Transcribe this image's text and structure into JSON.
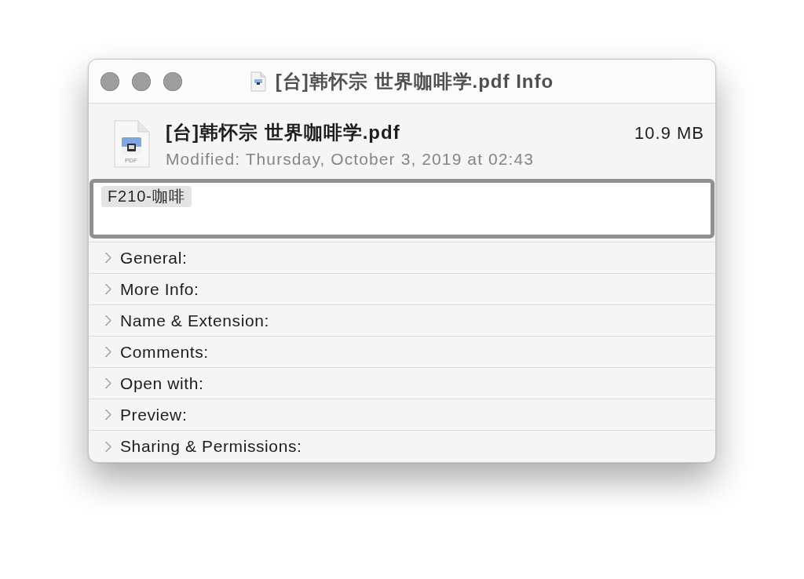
{
  "window": {
    "title": "[台]韩怀宗 世界咖啡学.pdf Info"
  },
  "file": {
    "name": "[台]韩怀宗 世界咖啡学.pdf",
    "size": "10.9 MB",
    "modified": "Modified: Thursday, October 3, 2019 at 02:43",
    "icon_label": "PDF"
  },
  "tags_field": {
    "tags": [
      {
        "label": "F210-咖啡"
      }
    ]
  },
  "sections": [
    {
      "label": "General:",
      "expanded": false
    },
    {
      "label": "More Info:",
      "expanded": false
    },
    {
      "label": "Name & Extension:",
      "expanded": false
    },
    {
      "label": "Comments:",
      "expanded": false
    },
    {
      "label": "Open with:",
      "expanded": false
    },
    {
      "label": "Preview:",
      "expanded": false
    },
    {
      "label": "Sharing & Permissions:",
      "expanded": false
    }
  ]
}
